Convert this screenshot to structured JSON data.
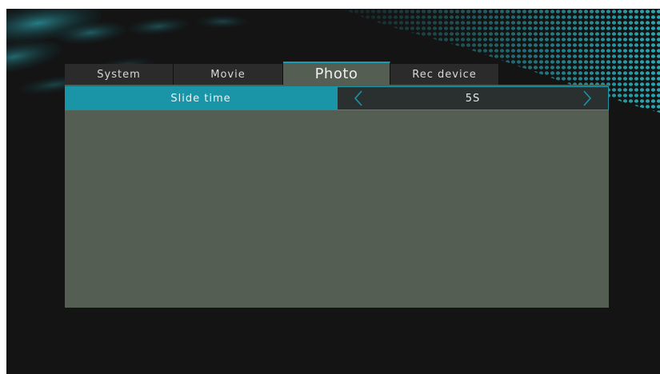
{
  "tabs": [
    {
      "label": "System",
      "active": false
    },
    {
      "label": "Movie",
      "active": false
    },
    {
      "label": "Photo",
      "active": true
    },
    {
      "label": "Rec device",
      "active": false
    }
  ],
  "settings": [
    {
      "label": "Slide time",
      "value": "5S",
      "selected": true
    }
  ],
  "icons": {
    "prev": "chevron-left-icon",
    "next": "chevron-right-icon"
  },
  "colors": {
    "accent": "#1a95a8",
    "panel": "#555e53",
    "screen_bg": "#141414",
    "tab_bg": "#2b2b2b"
  }
}
